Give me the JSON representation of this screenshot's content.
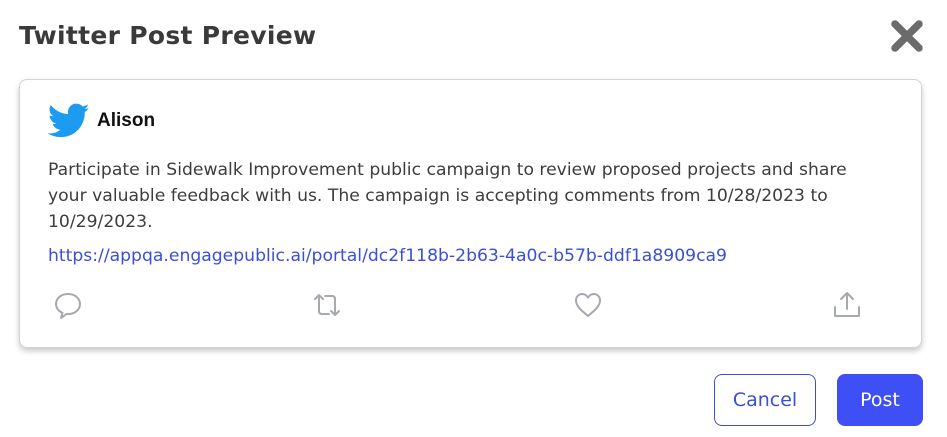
{
  "dialog": {
    "title": "Twitter Post Preview",
    "close_icon": "close-icon"
  },
  "post": {
    "author": "Alison",
    "message": "Participate in Sidewalk Improvement public campaign to review proposed projects and share your valuable feedback with us. The campaign is accepting comments from 10/28/2023 to 10/29/2023.",
    "link": "https://appqa.engagepublic.ai/portal/dc2f118b-2b63-4a0c-b57b-ddf1a8909ca9",
    "actions": [
      "reply-icon",
      "retweet-icon",
      "like-icon",
      "share-icon"
    ]
  },
  "footer": {
    "cancel_label": "Cancel",
    "post_label": "Post"
  },
  "colors": {
    "accent": "#3d4ff5",
    "link": "#3b4fd6",
    "twitter_blue": "#1d9bf0",
    "icon_gray": "#a6aab0"
  }
}
